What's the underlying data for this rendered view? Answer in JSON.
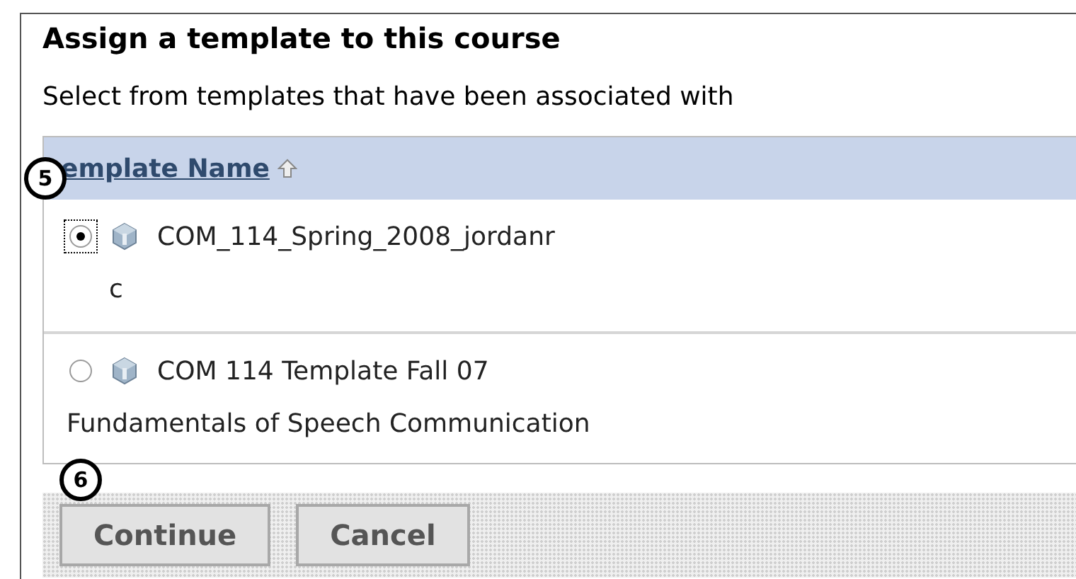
{
  "heading": "Assign a template to this course",
  "intro": "Select from templates that have been associated with",
  "table": {
    "columns": [
      {
        "label": "emplate Name",
        "sorted_ascending": true
      }
    ],
    "rows": [
      {
        "name": "COM_114_Spring_2008_jordanr",
        "description": "c",
        "selected": true
      },
      {
        "name": "COM 114 Template Fall 07",
        "description": "Fundamentals of Speech Communication",
        "selected": false
      }
    ]
  },
  "callouts": [
    {
      "number": "5"
    },
    {
      "number": "6"
    }
  ],
  "buttons": [
    {
      "label": "Continue"
    },
    {
      "label": "Cancel"
    }
  ]
}
